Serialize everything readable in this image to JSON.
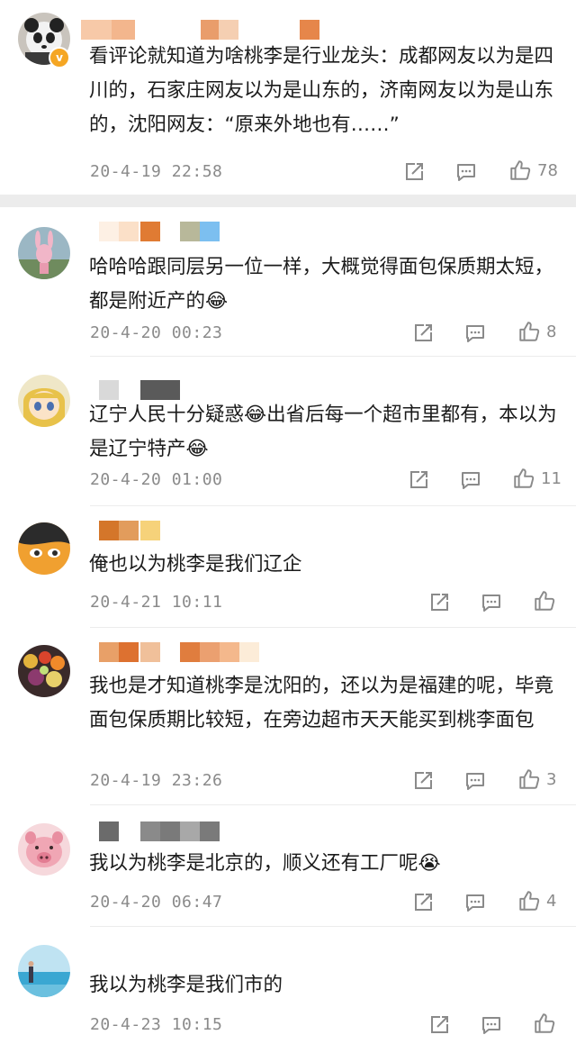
{
  "comments": [
    {
      "text": "看评论就知道为啥桃李是行业龙头：成都网友以为是四川的，石家庄网友以为是山东的，济南网友以为是山东的，沈阳网友：“原来外地也有……”",
      "time": "20-4-19 22:58",
      "likes": "78",
      "verified": true
    },
    {
      "text": "哈哈哈跟同层另一位一样，大概觉得面包保质期太短，都是附近产的😂",
      "time": "20-4-20 00:23",
      "likes": "8"
    },
    {
      "text": "辽宁人民十分疑惑😂出省后每一个超市里都有，本以为是辽宁特产😂",
      "time": "20-4-20 01:00",
      "likes": "11"
    },
    {
      "text": "俺也以为桃李是我们辽企",
      "time": "20-4-21 10:11",
      "likes": ""
    },
    {
      "text": "我也是才知道桃李是沈阳的，还以为是福建的呢，毕竟面包保质期比较短，在旁边超市天天能买到桃李面包",
      "time": "20-4-19 23:26",
      "likes": "3"
    },
    {
      "text": "我以为桃李是北京的，顺义还有工厂呢😭",
      "time": "20-4-20 06:47",
      "likes": "4"
    },
    {
      "text": "我以为桃李是我们市的",
      "time": "20-4-23 10:15",
      "likes": ""
    }
  ],
  "colors": {
    "text": "#1b1b1b",
    "meta": "#8a8a8a",
    "icon": "#8a8a8a",
    "divider": "#ececec",
    "verified_badge": "#f5a623"
  },
  "icons": {
    "share": "share-icon",
    "comment": "comment-icon",
    "like": "thumbs-up-icon"
  }
}
